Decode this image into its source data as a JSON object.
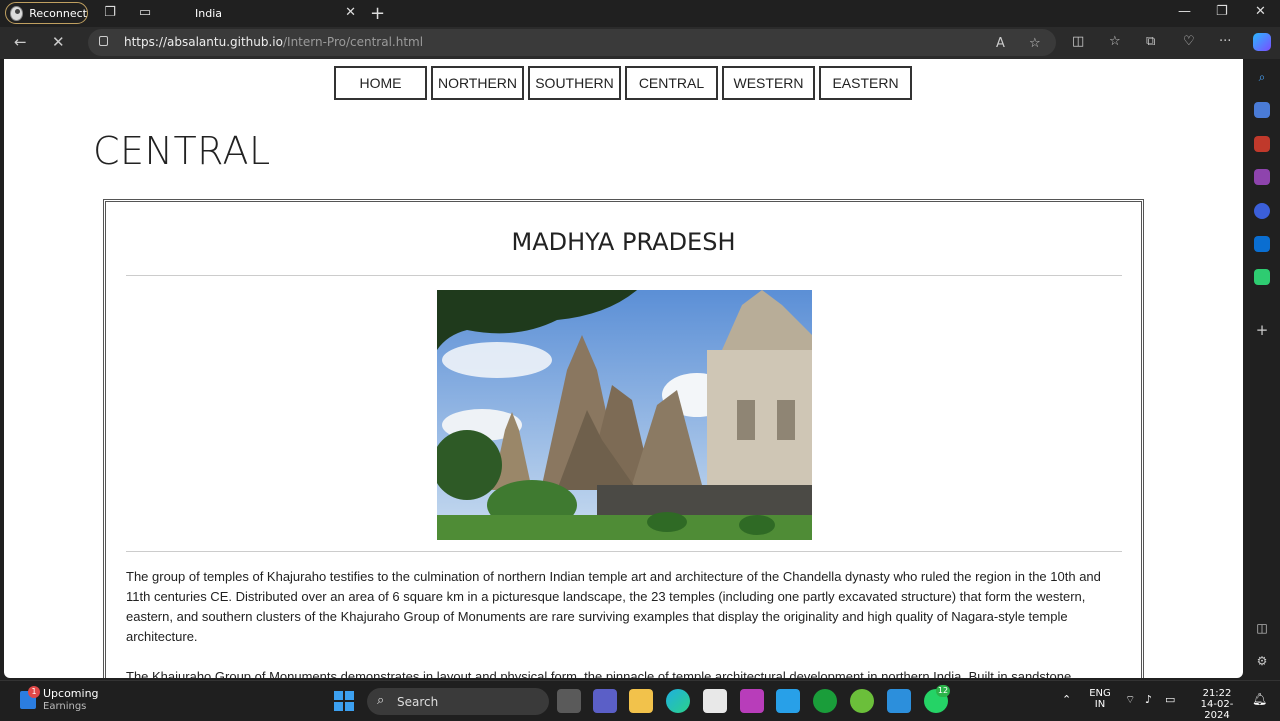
{
  "browser": {
    "reconnect_label": "Reconnect",
    "tab_title": "India",
    "url_host": "https://absalantu.github.io",
    "url_path": "/Intern-Pro/central.html"
  },
  "page": {
    "nav": [
      "HOME",
      "NORTHERN",
      "SOUTHERN",
      "CENTRAL",
      "WESTERN",
      "EASTERN"
    ],
    "title": "CENTRAL",
    "card": {
      "state": "MADHYA PRADESH",
      "para1": "The group of temples of Khajuraho testifies to the culmination of northern Indian temple art and architecture of the Chandella dynasty who ruled the region in the 10th and 11th centuries CE. Distributed over an area of 6 square km in a picturesque landscape, the 23 temples (including one partly excavated structure) that form the western, eastern, and southern clusters of the Khajuraho Group of Monuments are rare surviving examples that display the originality and high quality of Nagara-style temple architecture.",
      "para2": "The Khajuraho Group of Monuments demonstrates in layout and physical form, the pinnacle of temple architectural development in northern India. Built in sandstone"
    }
  },
  "taskbar": {
    "widget_title": "Upcoming",
    "widget_sub": "Earnings",
    "widget_badge": "1",
    "search_label": "Search",
    "whatsapp_badge": "12",
    "lang": "ENG",
    "region": "IN",
    "time": "21:22",
    "date": "14-02-2024"
  }
}
